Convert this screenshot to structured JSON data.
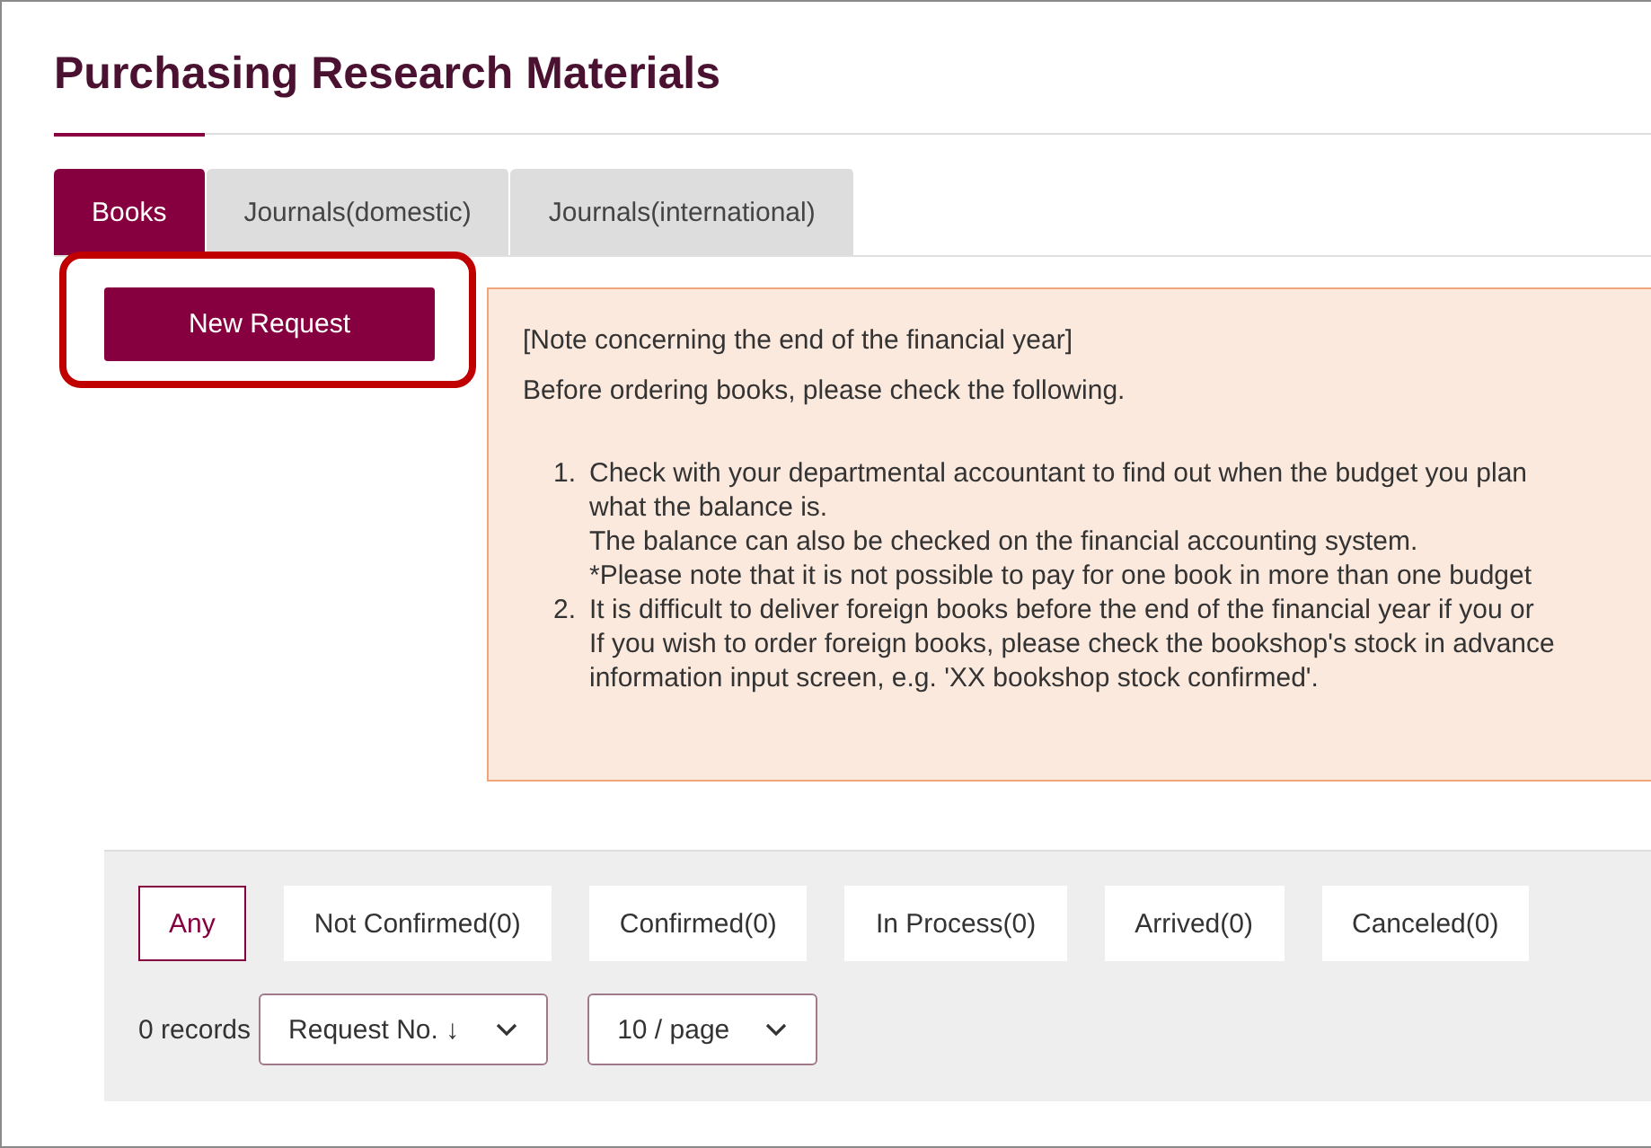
{
  "page": {
    "title": "Purchasing Research Materials"
  },
  "tabs": [
    {
      "label": "Books",
      "selected": true
    },
    {
      "label": "Journals(domestic)",
      "selected": false
    },
    {
      "label": "Journals(international)",
      "selected": false
    }
  ],
  "new_request_button": {
    "label": "New Request",
    "highlighted": true
  },
  "notice": {
    "heading": "[Note concerning the end of the financial year]",
    "intro": "Before ordering books, please check the following.",
    "items": [
      {
        "number": "1.",
        "lines": [
          "Check with your departmental accountant to find out when the budget you plan",
          "what the balance is.",
          "The balance can also be checked on the financial accounting system.",
          "*Please note that it is not possible to pay for one book in more than one budget"
        ]
      },
      {
        "number": "2.",
        "lines": [
          "It is difficult to deliver foreign books before the end of the financial year if you or",
          "If you wish to order foreign books, please check the bookshop's stock in advance",
          "information input screen, e.g. 'XX bookshop stock confirmed'."
        ]
      }
    ]
  },
  "status_filters": [
    {
      "label": "Any",
      "selected": true
    },
    {
      "label": "Not Confirmed(0)",
      "selected": false
    },
    {
      "label": "Confirmed(0)",
      "selected": false
    },
    {
      "label": "In Process(0)",
      "selected": false
    },
    {
      "label": "Arrived(0)",
      "selected": false
    },
    {
      "label": "Canceled(0)",
      "selected": false
    }
  ],
  "record_count": "0 records",
  "sort_select": {
    "value": "Request No. ↓"
  },
  "page_size_select": {
    "value": "10 / page"
  }
}
